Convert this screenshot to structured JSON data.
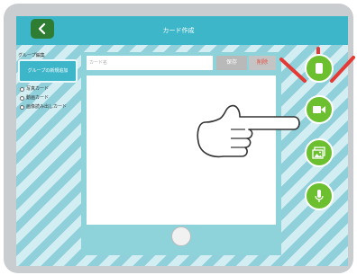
{
  "header": {
    "title": "カード作成"
  },
  "sidebar": {
    "group_heading": "グループ編集",
    "new_group_label": "グループの新規追加",
    "card_types": [
      {
        "label": "写真カード"
      },
      {
        "label": "動画カード"
      },
      {
        "label": "画像読み出しカード"
      }
    ]
  },
  "editor": {
    "card_name_placeholder": "カード名",
    "save_label": "保存",
    "delete_label": "削除"
  },
  "media_buttons": [
    "text-icon",
    "video-camera-icon",
    "photo-icon",
    "microphone-icon"
  ],
  "colors": {
    "accent": "#3db6c9",
    "green": "#6cbf2f",
    "back_button": "#2e7d32",
    "delete_text": "#e74c3c",
    "highlight_rays": "#e53935"
  }
}
